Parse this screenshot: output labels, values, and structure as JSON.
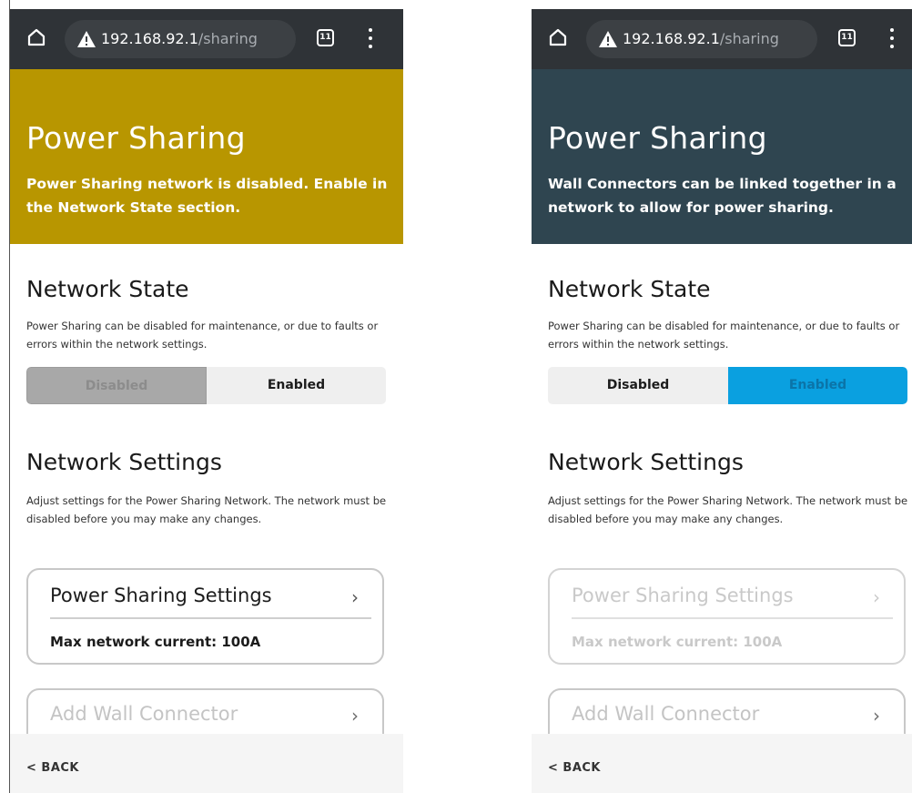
{
  "screens": [
    {
      "url": {
        "host": "192.168.92.1",
        "path": "/sharing"
      },
      "tab_count": "11",
      "banner": {
        "title": "Power Sharing",
        "description": "Power Sharing network is disabled. Enable in the Network State section.",
        "color": "#b89600"
      },
      "network_state": {
        "title": "Network State",
        "description": "Power Sharing can be disabled for maintenance, or due to faults or errors within the network settings.",
        "options": [
          "Disabled",
          "Enabled"
        ],
        "selected": "Disabled"
      },
      "network_settings": {
        "title": "Network Settings",
        "description": "Adjust settings for the Power Sharing Network. The network must be disabled before you may make any changes.",
        "card_title": "Power Sharing Settings",
        "card_detail": "Max network current: 100A",
        "card_enabled": true,
        "add_connector_label": "Add Wall Connector"
      },
      "back_label": "< BACK"
    },
    {
      "url": {
        "host": "192.168.92.1",
        "path": "/sharing"
      },
      "tab_count": "11",
      "banner": {
        "title": "Power Sharing",
        "description": "Wall Connectors can be linked together in a network to allow for power sharing.",
        "color": "#2f4550"
      },
      "network_state": {
        "title": "Network State",
        "description": "Power Sharing can be disabled for maintenance, or due to faults or errors within the network settings.",
        "options": [
          "Disabled",
          "Enabled"
        ],
        "selected": "Enabled"
      },
      "network_settings": {
        "title": "Network Settings",
        "description": "Adjust settings for the Power Sharing Network. The network must be disabled before you may make any changes.",
        "card_title": "Power Sharing Settings",
        "card_detail": "Max network current: 100A",
        "card_enabled": false,
        "add_connector_label": "Add Wall Connector"
      },
      "back_label": "< BACK"
    }
  ]
}
